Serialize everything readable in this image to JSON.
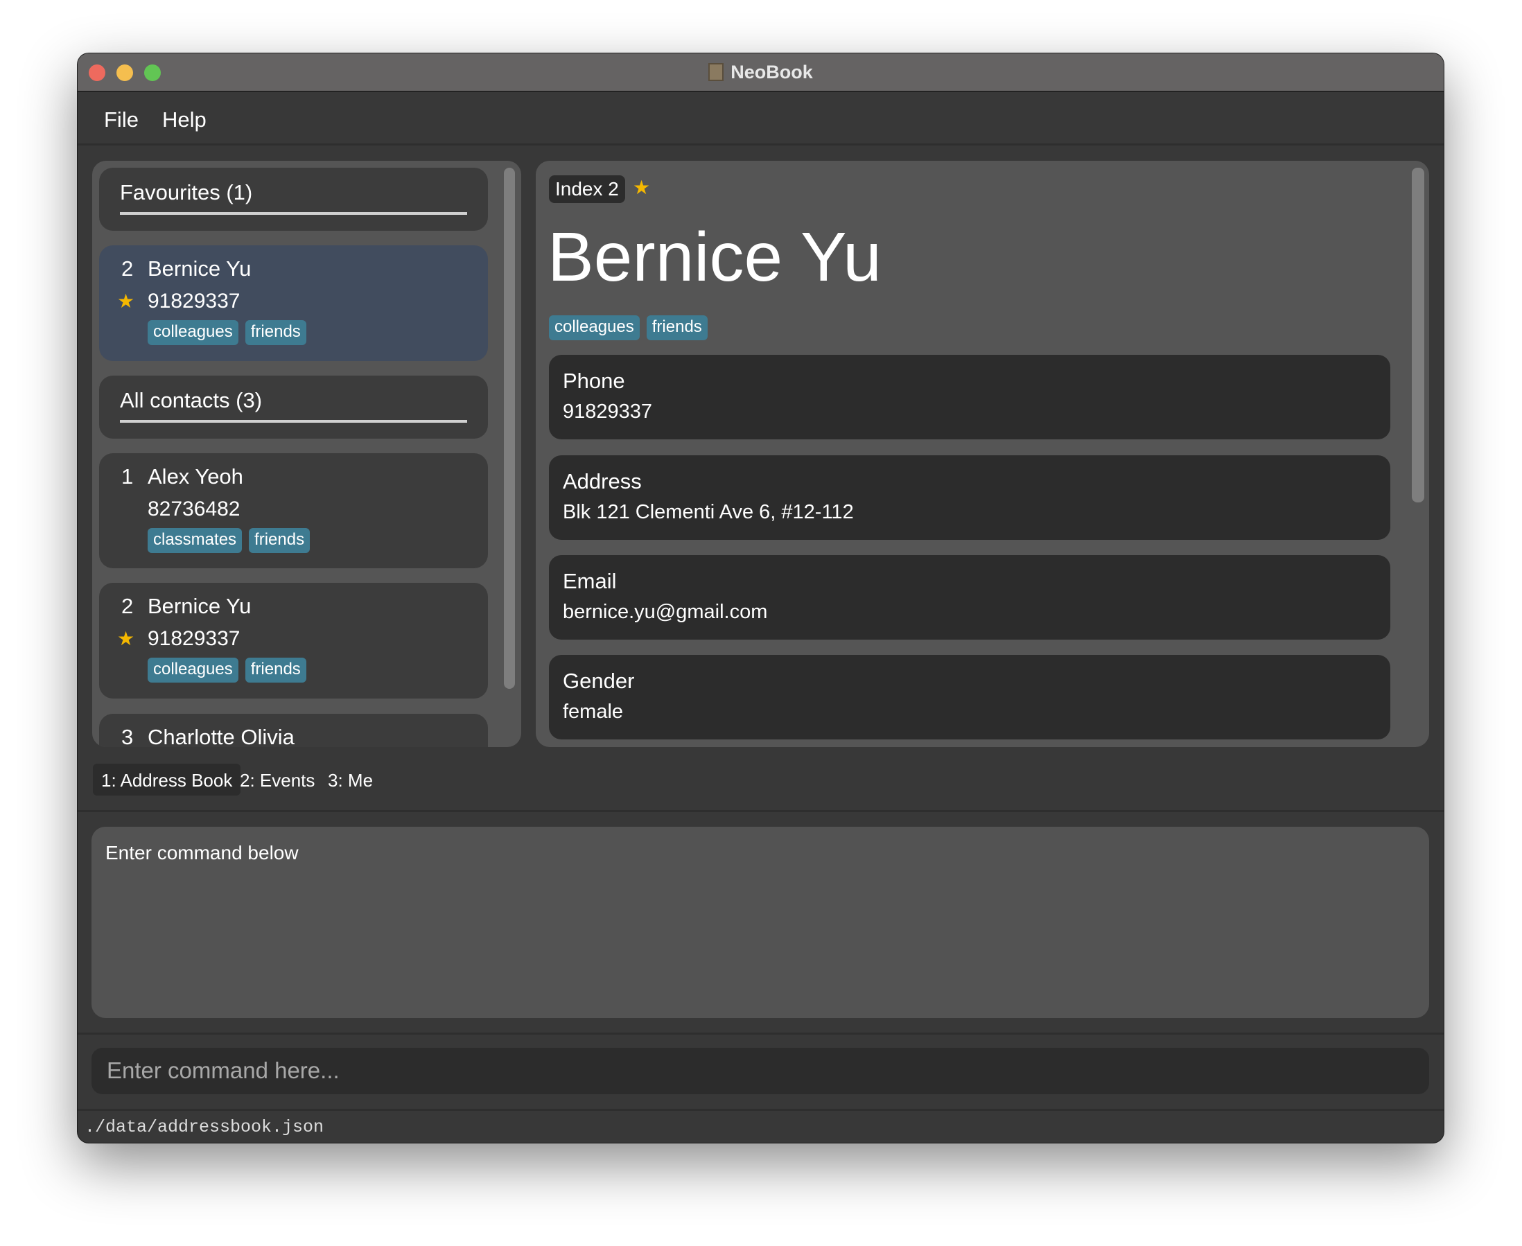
{
  "window": {
    "title": "NeoBook",
    "controls": {
      "close": "#ee6a5e",
      "minimize": "#f5be4f",
      "maximize": "#62c554"
    }
  },
  "menu": [
    "File",
    "Help"
  ],
  "list": {
    "favourites_header": "Favourites (1)",
    "favourites": [
      {
        "index": "2",
        "name": "Bernice Yu",
        "phone": "91829337",
        "favourite": true,
        "tags": [
          "colleagues",
          "friends"
        ]
      }
    ],
    "all_header": "All contacts (3)",
    "contacts": [
      {
        "index": "1",
        "name": "Alex Yeoh",
        "phone": "82736482",
        "favourite": false,
        "tags": [
          "classmates",
          "friends"
        ]
      },
      {
        "index": "2",
        "name": "Bernice Yu",
        "phone": "91829337",
        "favourite": true,
        "tags": [
          "colleagues",
          "friends"
        ]
      },
      {
        "index": "3",
        "name": "Charlotte Olivia"
      }
    ]
  },
  "detail": {
    "index_label": "Index 2",
    "favourite": true,
    "name": "Bernice Yu",
    "tags": [
      "colleagues",
      "friends"
    ],
    "fields": [
      {
        "label": "Phone",
        "value": "91829337"
      },
      {
        "label": "Address",
        "value": "Blk 121 Clementi Ave 6, #12-112"
      },
      {
        "label": "Email",
        "value": "bernice.yu@gmail.com"
      },
      {
        "label": "Gender",
        "value": "female"
      }
    ]
  },
  "tabs": [
    {
      "label": "1: Address Book",
      "active": true
    },
    {
      "label": "2: Events"
    },
    {
      "label": "3: Me"
    }
  ],
  "result": {
    "text": "Enter command below"
  },
  "command": {
    "placeholder": "Enter command here..."
  },
  "status": {
    "path": "./data/addressbook.json"
  },
  "colors": {
    "tag": "#3e7b91",
    "selected_card": "#414c5e",
    "star": "#f5b800"
  }
}
